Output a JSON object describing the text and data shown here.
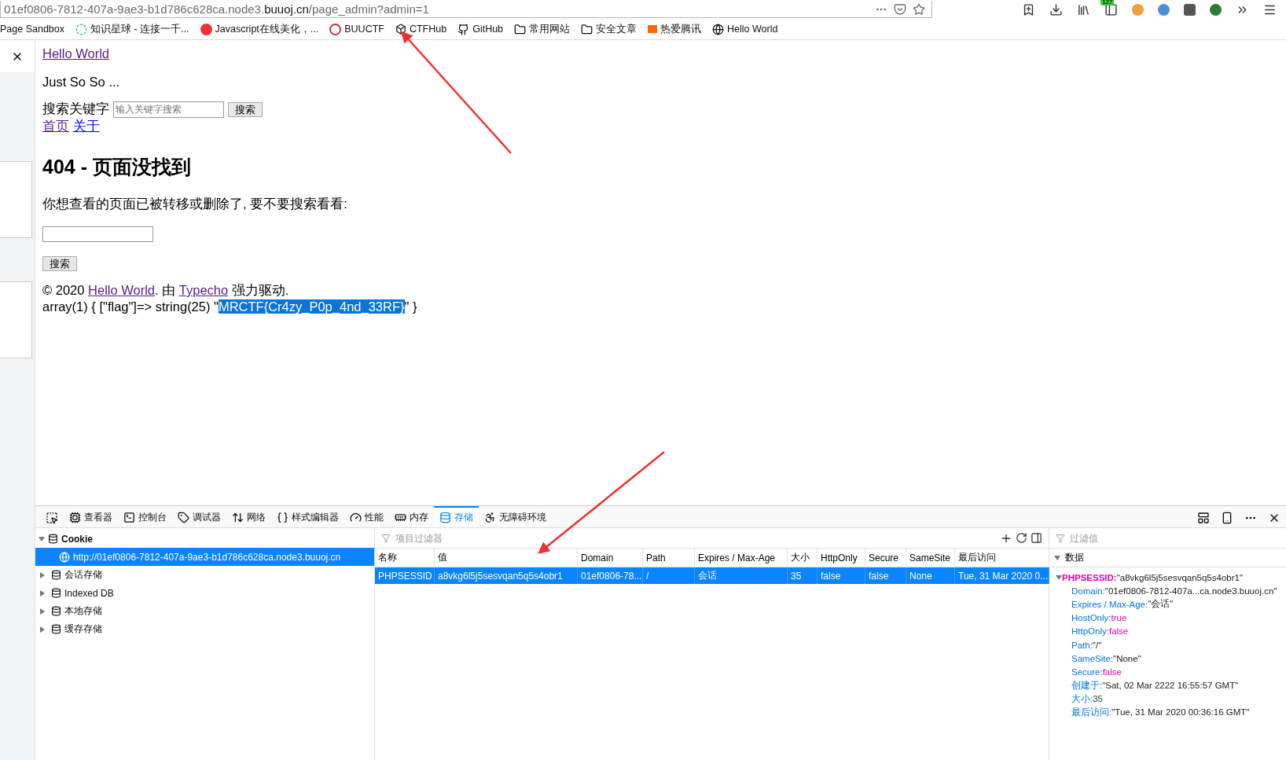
{
  "address_bar": {
    "url": "01ef0806-7812-407a-9ae3-b1d786c628ca.node3.**buuoj.cn**/page_admin?admin=1"
  },
  "toolbar_badge": "127",
  "bookmarks": [
    {
      "label": "Page Sandbox",
      "kind": "plain"
    },
    {
      "label": "知识星球 - 连接一千...",
      "kind": "ring"
    },
    {
      "label": "Javascript在线美化，...",
      "kind": "html"
    },
    {
      "label": "BUUCTF",
      "kind": "seal"
    },
    {
      "label": "CTFHub",
      "kind": "cube"
    },
    {
      "label": "GitHub",
      "kind": "github"
    },
    {
      "label": "常用网站",
      "kind": "folder"
    },
    {
      "label": "安全文章",
      "kind": "folder"
    },
    {
      "label": "热爱腾讯",
      "kind": "flag"
    },
    {
      "label": "Hello World",
      "kind": "globe"
    }
  ],
  "page": {
    "site_title": "Hello World",
    "tagline": "Just So So ...",
    "search_label": "搜索关键字",
    "search_placeholder": "输入关键字搜索",
    "search_button": "搜索",
    "nav_links": [
      "首页",
      "关于"
    ],
    "heading": "404 - 页面没找到",
    "message": "你想查看的页面已被转移或删除了, 要不要搜索看看:",
    "search_button_2": "搜索",
    "footer": {
      "prefix": "© 2020 ",
      "site_link": "Hello World",
      "middle": ". 由 ",
      "engine_link": "Typecho",
      "suffix": " 强力驱动."
    },
    "dump": {
      "before": "array(1) { [\"flag\"]=> string(25) \"",
      "selected_text": "MRCTF{Cr4zy_P0p_4nd_33RF}",
      "after": "\" }"
    }
  },
  "devtools": {
    "tabs": [
      {
        "label": "查看器",
        "kind": "chip",
        "selected": false
      },
      {
        "label": "控制台",
        "kind": "console",
        "selected": false
      },
      {
        "label": "调试器",
        "kind": "debugger",
        "selected": false
      },
      {
        "label": "网络",
        "kind": "network",
        "selected": false
      },
      {
        "label": "样式编辑器",
        "kind": "braces",
        "selected": false
      },
      {
        "label": "性能",
        "kind": "gauge",
        "selected": false
      },
      {
        "label": "内存",
        "kind": "memory",
        "selected": false
      },
      {
        "label": "存储",
        "kind": "storage",
        "selected": true
      },
      {
        "label": "无障碍环境",
        "kind": "person",
        "selected": false
      }
    ],
    "tree": [
      {
        "label": "Cookie",
        "expanded": true,
        "children": [
          {
            "label": "http://01ef0806-7812-407a-9ae3-b1d786c628ca.node3.buuoj.cn",
            "selected": true
          }
        ]
      },
      {
        "label": "会话存储",
        "expanded": false
      },
      {
        "label": "Indexed DB",
        "expanded": false
      },
      {
        "label": "本地存储",
        "expanded": false
      },
      {
        "label": "缓存存储",
        "expanded": false
      }
    ],
    "filter_placeholder": "项目过滤器",
    "table": {
      "columns": [
        "名称",
        "值",
        "Domain",
        "Path",
        "Expires / Max-Age",
        "大小",
        "HttpOnly",
        "Secure",
        "SameSite",
        "最后访问"
      ],
      "rows": [
        {
          "selected": true,
          "cells": [
            "PHPSESSID",
            "a8vkg6l5j5sesvqan5q5s4obr1",
            "01ef0806-78...",
            "/",
            "会话",
            "35",
            "false",
            "false",
            "None",
            "Tue, 31 Mar 2020 0..."
          ]
        }
      ]
    },
    "sidebar": {
      "filter_placeholder": "过滤值",
      "section": "数据",
      "expanded": true,
      "entry": {
        "name": "PHPSESSID:",
        "value": "\"a8vkg6l5j5sesvqan5q5s4obr1\"",
        "expanded": true
      },
      "fields": [
        {
          "key": "Domain:",
          "value": "\"01ef0806-7812-407a...ca.node3.buuoj.cn\"",
          "kind": "string"
        },
        {
          "key": "Expires / Max-Age:",
          "value": "\"会话\"",
          "kind": "string"
        },
        {
          "key": "HostOnly:",
          "value": "true",
          "kind": "boolean"
        },
        {
          "key": "HttpOnly:",
          "value": "false",
          "kind": "boolean"
        },
        {
          "key": "Path:",
          "value": "\"/\"",
          "kind": "string"
        },
        {
          "key": "SameSite:",
          "value": "\"None\"",
          "kind": "string"
        },
        {
          "key": "Secure:",
          "value": "false",
          "kind": "boolean"
        },
        {
          "key": "创建于:",
          "value": "\"Sat, 02 Mar 2222 16:55:57 GMT\"",
          "kind": "string"
        },
        {
          "key": "大小:",
          "value": "35",
          "kind": "number"
        },
        {
          "key": "最后访问:",
          "value": "\"Tue, 31 Mar 2020 00:36:16 GMT\"",
          "kind": "string"
        }
      ]
    }
  }
}
